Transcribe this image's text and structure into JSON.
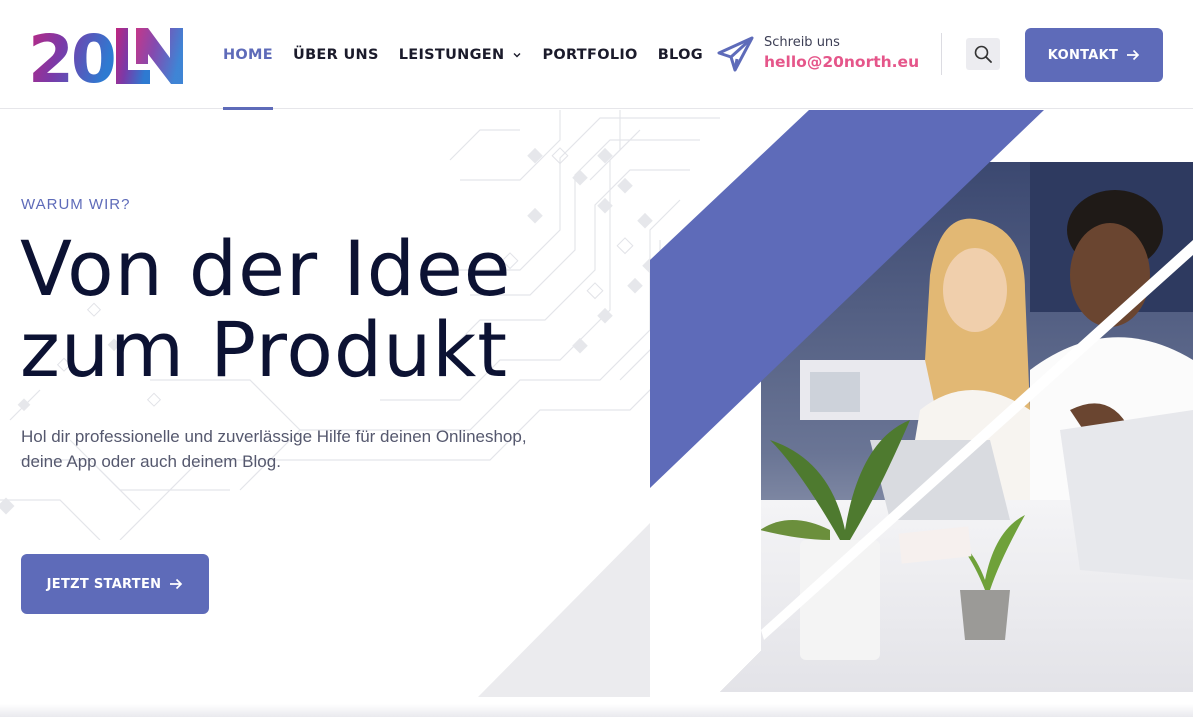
{
  "brand": {
    "logo_text": "20N",
    "logo_alt": "20north logo"
  },
  "nav": {
    "items": [
      {
        "label": "HOME",
        "active": true
      },
      {
        "label": "ÜBER UNS",
        "active": false
      },
      {
        "label": "LEISTUNGEN",
        "active": false,
        "has_dropdown": true
      },
      {
        "label": "PORTFOLIO",
        "active": false
      },
      {
        "label": "BLOG",
        "active": false
      }
    ]
  },
  "contact": {
    "label": "Schreib uns",
    "email": "hello@20north.eu",
    "icon": "paper-plane-icon"
  },
  "header_actions": {
    "search_icon": "search-icon",
    "kontakt_label": "KONTAKT",
    "kontakt_icon": "arrow-right-icon"
  },
  "hero": {
    "eyebrow": "WARUM WIR?",
    "headline_line1": "Von der Idee",
    "headline_line2": "zum Produkt",
    "subtext": "Hol dir professionelle und zuverlässige Hilfe für deinen Onlineshop, deine App oder auch deinem Blog.",
    "cta_label": "JETZT STARTEN",
    "cta_icon": "arrow-right-icon",
    "image": "photo of two people at an office desk with laptops and plants"
  },
  "colors": {
    "primary": "#5e6bb9",
    "accent_pink": "#e5568a",
    "heading": "#0c1233",
    "text": "#55586e",
    "nav_text": "#1b1b2b"
  }
}
